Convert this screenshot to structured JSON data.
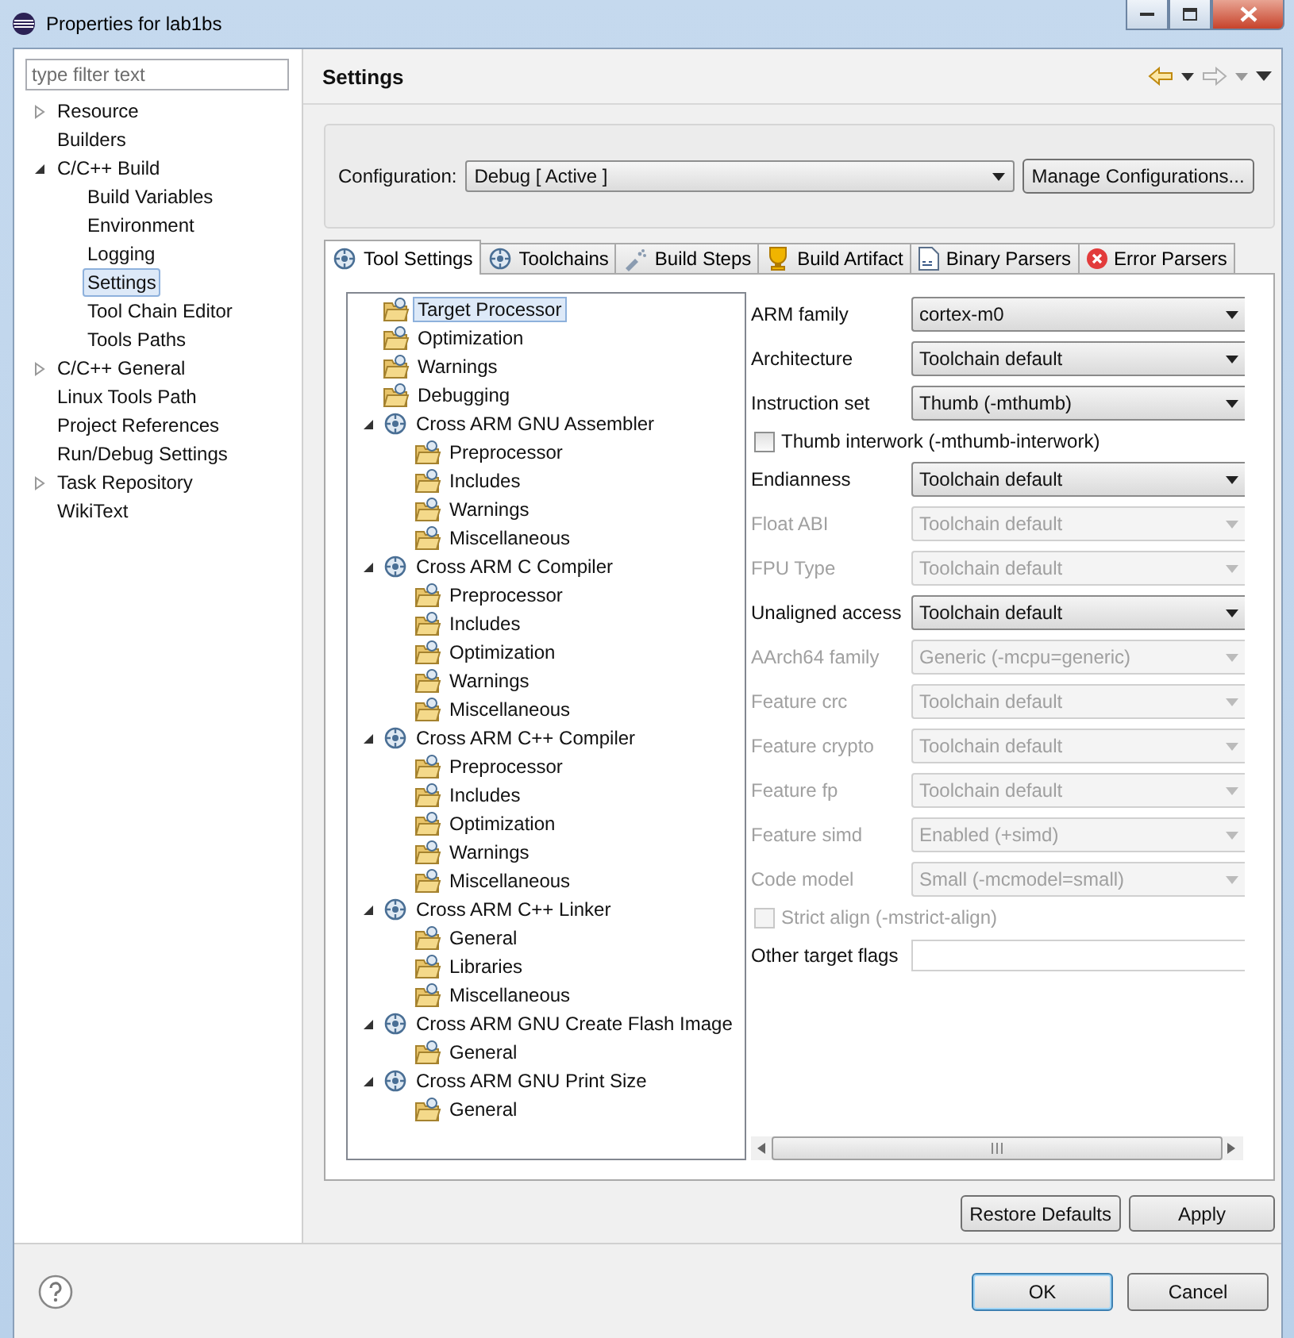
{
  "window": {
    "title": "Properties for lab1bs"
  },
  "filter": {
    "placeholder": "type filter text"
  },
  "nav": [
    {
      "label": "Resource",
      "expanded": false,
      "selected": false
    },
    {
      "label": "Builders",
      "selected": false
    },
    {
      "label": "C/C++ Build",
      "expanded": true,
      "selected": false,
      "children": [
        {
          "label": "Build Variables",
          "selected": false
        },
        {
          "label": "Environment",
          "selected": false
        },
        {
          "label": "Logging",
          "selected": false
        },
        {
          "label": "Settings",
          "selected": true
        },
        {
          "label": "Tool Chain Editor",
          "selected": false
        },
        {
          "label": "Tools Paths",
          "selected": false
        }
      ]
    },
    {
      "label": "C/C++ General",
      "expanded": false,
      "selected": false
    },
    {
      "label": "Linux Tools Path",
      "selected": false
    },
    {
      "label": "Project References",
      "selected": false
    },
    {
      "label": "Run/Debug Settings",
      "selected": false
    },
    {
      "label": "Task Repository",
      "expanded": false,
      "selected": false
    },
    {
      "label": "WikiText",
      "selected": false
    }
  ],
  "header": {
    "title": "Settings"
  },
  "configuration": {
    "label": "Configuration:",
    "value": "Debug  [ Active ]",
    "button": "Manage Configurations..."
  },
  "tabs": [
    {
      "label": "Tool Settings",
      "selected": true
    },
    {
      "label": "Toolchains",
      "selected": false
    },
    {
      "label": "Build Steps",
      "selected": false
    },
    {
      "label": "Build Artifact",
      "selected": false
    },
    {
      "label": "Binary Parsers",
      "selected": false
    },
    {
      "label": "Error Parsers",
      "selected": false
    }
  ],
  "tool_tree": [
    {
      "label": "Target Processor",
      "selected": true
    },
    {
      "label": "Optimization",
      "selected": false
    },
    {
      "label": "Warnings",
      "selected": false
    },
    {
      "label": "Debugging",
      "selected": false
    },
    {
      "label": "Cross ARM GNU Assembler",
      "expanded": true,
      "selected": false,
      "children": [
        {
          "label": "Preprocessor",
          "selected": false
        },
        {
          "label": "Includes",
          "selected": false
        },
        {
          "label": "Warnings",
          "selected": false
        },
        {
          "label": "Miscellaneous",
          "selected": false
        }
      ]
    },
    {
      "label": "Cross ARM C Compiler",
      "expanded": true,
      "selected": false,
      "children": [
        {
          "label": "Preprocessor",
          "selected": false
        },
        {
          "label": "Includes",
          "selected": false
        },
        {
          "label": "Optimization",
          "selected": false
        },
        {
          "label": "Warnings",
          "selected": false
        },
        {
          "label": "Miscellaneous",
          "selected": false
        }
      ]
    },
    {
      "label": "Cross ARM C++ Compiler",
      "expanded": true,
      "selected": false,
      "children": [
        {
          "label": "Preprocessor",
          "selected": false
        },
        {
          "label": "Includes",
          "selected": false
        },
        {
          "label": "Optimization",
          "selected": false
        },
        {
          "label": "Warnings",
          "selected": false
        },
        {
          "label": "Miscellaneous",
          "selected": false
        }
      ]
    },
    {
      "label": "Cross ARM C++ Linker",
      "expanded": true,
      "selected": false,
      "children": [
        {
          "label": "General",
          "selected": false
        },
        {
          "label": "Libraries",
          "selected": false
        },
        {
          "label": "Miscellaneous",
          "selected": false
        }
      ]
    },
    {
      "label": "Cross ARM GNU Create Flash Image",
      "expanded": true,
      "selected": false,
      "children": [
        {
          "label": "General",
          "selected": false
        }
      ]
    },
    {
      "label": "Cross ARM GNU Print Size",
      "expanded": true,
      "selected": false,
      "children": [
        {
          "label": "General",
          "selected": false
        }
      ]
    }
  ],
  "options": [
    {
      "kind": "select",
      "label": "ARM family",
      "value": "cortex-m0",
      "disabled": false
    },
    {
      "kind": "select",
      "label": "Architecture",
      "value": "Toolchain default",
      "disabled": false
    },
    {
      "kind": "select",
      "label": "Instruction set",
      "value": "Thumb (-mthumb)",
      "disabled": false
    },
    {
      "kind": "checkbox",
      "label": "Thumb interwork (-mthumb-interwork)",
      "checked": false,
      "disabled": false
    },
    {
      "kind": "select",
      "label": "Endianness",
      "value": "Toolchain default",
      "disabled": false
    },
    {
      "kind": "select",
      "label": "Float ABI",
      "value": "Toolchain default",
      "disabled": true
    },
    {
      "kind": "select",
      "label": "FPU Type",
      "value": "Toolchain default",
      "disabled": true
    },
    {
      "kind": "select",
      "label": "Unaligned access",
      "value": "Toolchain default",
      "disabled": false
    },
    {
      "kind": "select",
      "label": "AArch64 family",
      "value": "Generic (-mcpu=generic)",
      "disabled": true
    },
    {
      "kind": "select",
      "label": "Feature crc",
      "value": "Toolchain default",
      "disabled": true
    },
    {
      "kind": "select",
      "label": "Feature crypto",
      "value": "Toolchain default",
      "disabled": true
    },
    {
      "kind": "select",
      "label": "Feature fp",
      "value": "Toolchain default",
      "disabled": true
    },
    {
      "kind": "select",
      "label": "Feature simd",
      "value": "Enabled (+simd)",
      "disabled": true
    },
    {
      "kind": "select",
      "label": "Code model",
      "value": "Small (-mcmodel=small)",
      "disabled": true
    },
    {
      "kind": "checkbox",
      "label": "Strict align (-mstrict-align)",
      "checked": false,
      "disabled": true
    },
    {
      "kind": "text",
      "label": "Other target flags",
      "disabled": false
    }
  ],
  "page_buttons": [
    "Restore Defaults",
    "Apply"
  ],
  "dialog_buttons": [
    "OK",
    "Cancel"
  ]
}
